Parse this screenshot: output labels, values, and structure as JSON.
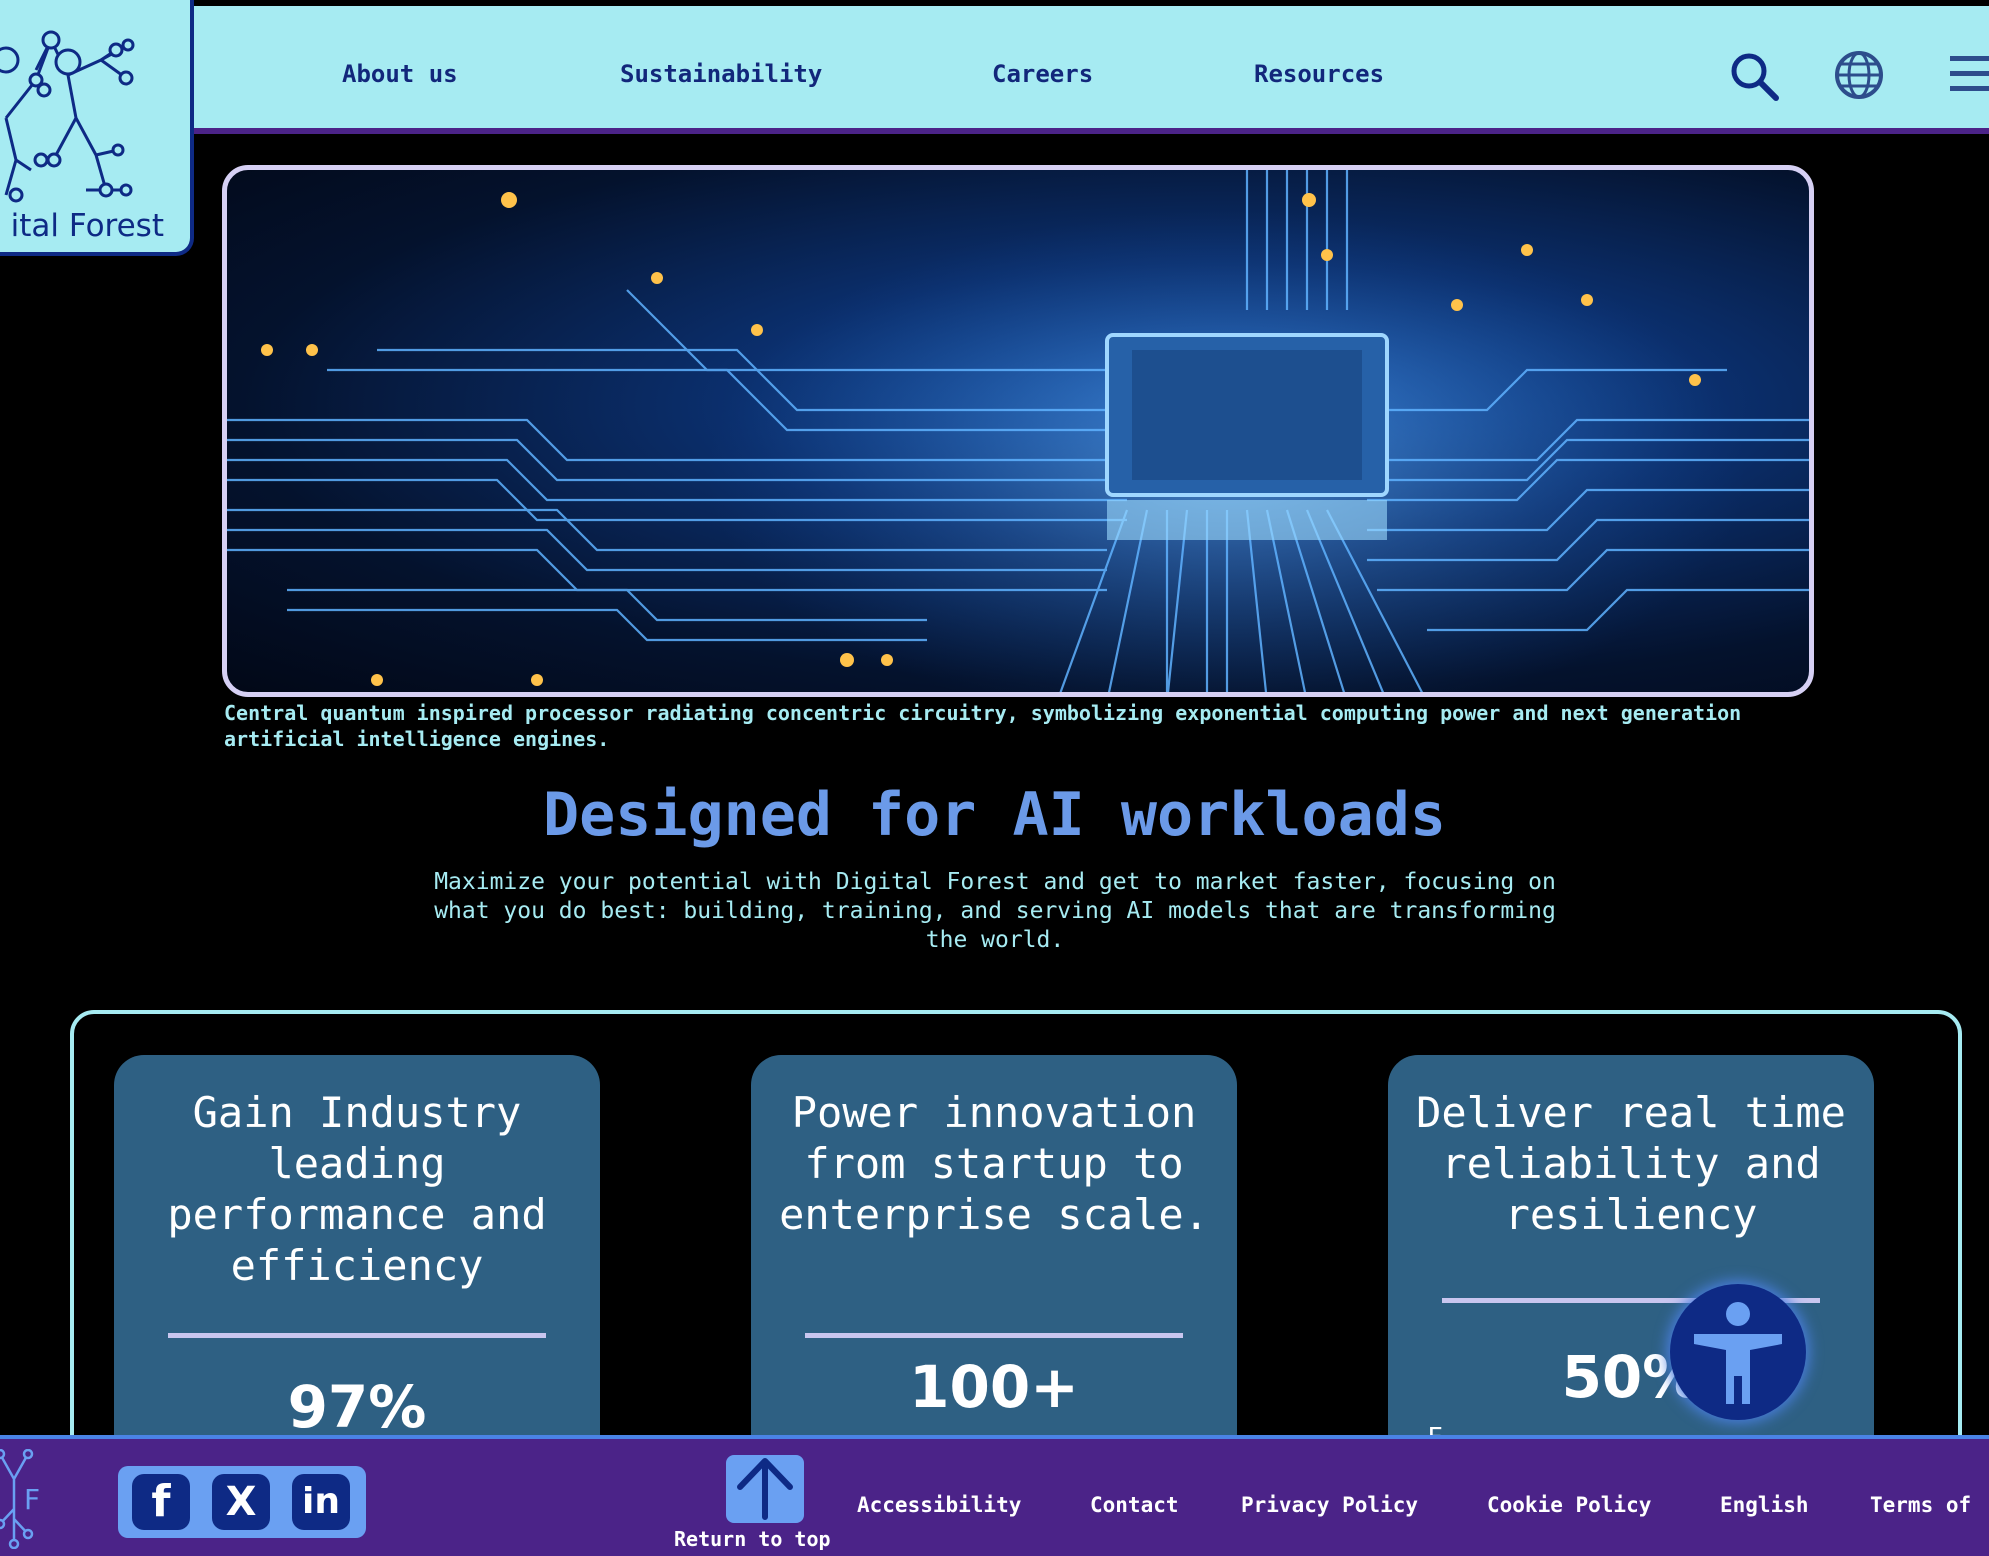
{
  "brand": {
    "logo_text": "ital Forest"
  },
  "nav": {
    "items": [
      {
        "label": "About us"
      },
      {
        "label": "Sustainability"
      },
      {
        "label": "Careers"
      },
      {
        "label": "Resources"
      }
    ],
    "icons": [
      "search-icon",
      "globe-icon",
      "menu-icon"
    ]
  },
  "hero": {
    "image_icon": "processor-circuit-image",
    "caption": "Central quantum inspired processor radiating concentric circuitry, symbolizing exponential computing power and next generation artificial intelligence engines."
  },
  "section": {
    "heading": "Designed for AI workloads",
    "intro": "Maximize your potential with Digital Forest and get to market faster, focusing on what you do best: building, training, and serving AI models that are transforming the world."
  },
  "stats": [
    {
      "title": "Gain Industry leading performance and efficiency",
      "value": "97%",
      "sub": ""
    },
    {
      "title": "Power innovation from startup to enterprise scale.",
      "value": "100+",
      "sub": ""
    },
    {
      "title": "Deliver real time reliability and resiliency",
      "value": "50%",
      "sub": "F"
    }
  ],
  "accessibility_button": {
    "icon": "accessibility-person-icon"
  },
  "footer": {
    "logo_letter": "F",
    "social": [
      {
        "name": "facebook-icon",
        "glyph": "f"
      },
      {
        "name": "x-icon",
        "glyph": "X"
      },
      {
        "name": "linkedin-icon",
        "glyph": "in"
      }
    ],
    "return_to_top": "Return to top",
    "links": [
      "Accessibility",
      "Contact",
      "Privacy Policy",
      "Cookie Policy",
      "English",
      "Terms of"
    ]
  },
  "colors": {
    "header_bg": "#a6ebf2",
    "header_text": "#12277b",
    "accent_blue": "#6b9ae8",
    "card_bg": "#2e6083",
    "footer_bg": "#4b2388"
  }
}
